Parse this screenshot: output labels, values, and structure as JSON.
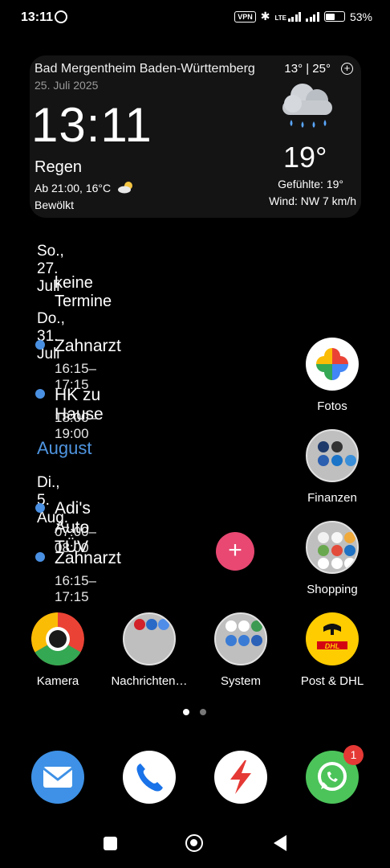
{
  "status_bar": {
    "time": "13:11",
    "vpn": "VPN",
    "network": "LTE",
    "battery": "53%",
    "battery_level": 0.53
  },
  "weather": {
    "location": "Bad Mergentheim Baden-Württemberg",
    "date": "25. Juli 2025",
    "time": "13:11",
    "condition": "Regen",
    "next_forecast": "Ab 21:00, 16°C",
    "next_icon": "partly-cloudy-icon",
    "sky": "Bewölkt",
    "range": "13° | 25°",
    "add_icon": "plus-circle-icon",
    "icon": "rain-cloud-icon",
    "temperature": "19°",
    "feels_like": "Gefühlte: 19°",
    "wind": "Wind: NW 7 km/h"
  },
  "agenda": {
    "day1": "So., 27. Juli",
    "no_events": "keine Termine",
    "day2": "Do., 31. Juli",
    "event1_title": "Zahnarzt",
    "event1_time": "16:15–17:15",
    "event2_title": "HK zu Hause",
    "event2_time": "18:00–19:00",
    "month": "August",
    "day3": "Di., 5. Aug.",
    "event3_title": "Adi's Auto TÜV",
    "event3_time": "07:00–08:00",
    "event4_title": "Zahnarzt",
    "event4_time": "16:15–17:15",
    "add_symbol": "+"
  },
  "apps": {
    "fotos": "Fotos",
    "finanzen": "Finanzen",
    "shopping": "Shopping",
    "kamera": "Kamera",
    "nachrichten": "Nachrichten…",
    "system": "System",
    "post": "Post & DHL",
    "dhl_logo_text": "DHL"
  },
  "dock": {
    "mail_icon": "mail-icon",
    "phone_icon": "phone-icon",
    "shortcut_icon": "lightning-app-icon",
    "whatsapp_icon": "whatsapp-icon",
    "whatsapp_badge": "1"
  },
  "pager": {
    "pages": 2,
    "active": 1
  },
  "colors": {
    "accent_blue": "#4f95e0",
    "fab_pink": "#e84872",
    "badge_red": "#e53935",
    "widget_bg": "#141414"
  }
}
